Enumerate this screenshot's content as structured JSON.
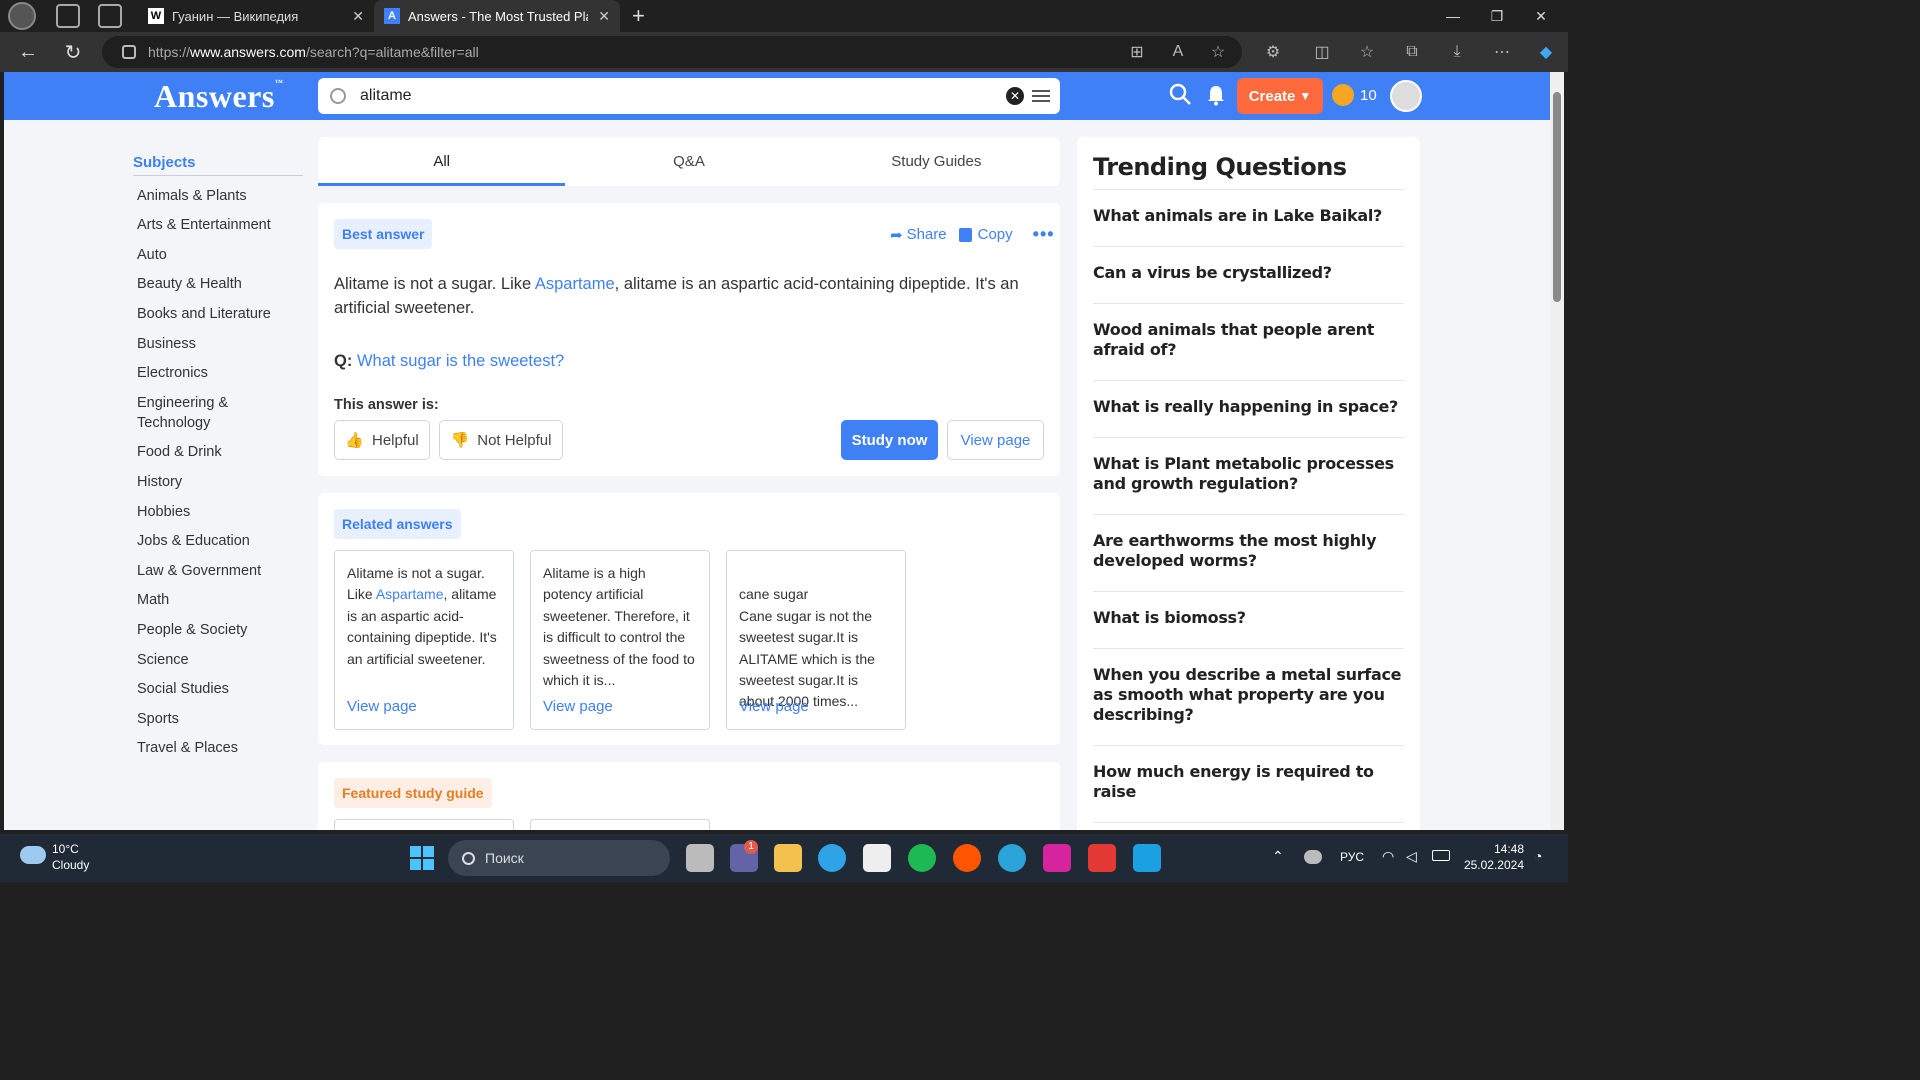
{
  "browser": {
    "tabs": [
      {
        "label": "Гуанин — Википедия",
        "favicon": "W"
      },
      {
        "label": "Answers - The Most Trusted Plac",
        "favicon": "A"
      }
    ],
    "url_prefix": "https://",
    "url_host": "www.answers.com",
    "url_path": "/search?q=alitame&filter=all"
  },
  "header": {
    "logo": "Answers",
    "logo_tm": "™",
    "search_value": "alitame",
    "create_label": "Create",
    "coins": "10"
  },
  "subjects": {
    "title": "Subjects",
    "items": [
      "Animals & Plants",
      "Arts & Entertainment",
      "Auto",
      "Beauty & Health",
      "Books and Literature",
      "Business",
      "Electronics",
      "Engineering & Technology",
      "Food & Drink",
      "History",
      "Hobbies",
      "Jobs & Education",
      "Law & Government",
      "Math",
      "People & Society",
      "Science",
      "Social Studies",
      "Sports",
      "Travel & Places"
    ]
  },
  "result_tabs": [
    "All",
    "Q&A",
    "Study Guides"
  ],
  "best_answer": {
    "badge": "Best answer",
    "share": "Share",
    "copy": "Copy",
    "text_pre": "Alitame is not a sugar. Like ",
    "text_link": "Aspartame",
    "text_post": ", alitame is an aspartic acid-containing dipeptide. It's an artificial sweetener.",
    "q_label": "Q:",
    "q_link": "What sugar is the sweetest?",
    "helpful_prompt": "This answer is:",
    "helpful": "Helpful",
    "not_helpful": "Not Helpful",
    "study_now": "Study now",
    "view_page": "View page"
  },
  "related": {
    "badge": "Related answers",
    "cards": [
      {
        "pre": "Alitame is not a sugar. Like ",
        "link": "Aspartame",
        "post": ", alitame is an aspartic acid-containing dipeptide. It's an artificial sweetener.",
        "view": "View page"
      },
      {
        "pre": "Alitame is a high potency artificial sweetener. Therefore, it is difficult to control the sweetness of the food to which it is...",
        "link": "",
        "post": "",
        "view": "View page"
      },
      {
        "pre": "cane sugar\nCane sugar is not the sweetest sugar.It is ALITAME which is the sweetest sugar.It is about 2000 times...",
        "link": "",
        "post": "",
        "view": "View page"
      }
    ]
  },
  "featured": {
    "badge": "Featured study guide"
  },
  "trending": {
    "title": "Trending Questions",
    "questions": [
      "What animals are in Lake Baikal?",
      "Can a virus be crystallized?",
      "Wood animals that people arent afraid of?",
      "What is really happening in space?",
      "What is Plant metabolic processes and growth regulation?",
      "Are earthworms the most highly developed worms?",
      "What is biomoss?",
      "When you describe a metal surface as smooth what property are you describing?",
      "How much energy is required to raise"
    ]
  },
  "taskbar": {
    "temp": "10°C",
    "weather": "Cloudy",
    "search": "Поиск",
    "lang": "РУС",
    "time": "14:48",
    "date": "25.02.2024",
    "badge": "1"
  }
}
